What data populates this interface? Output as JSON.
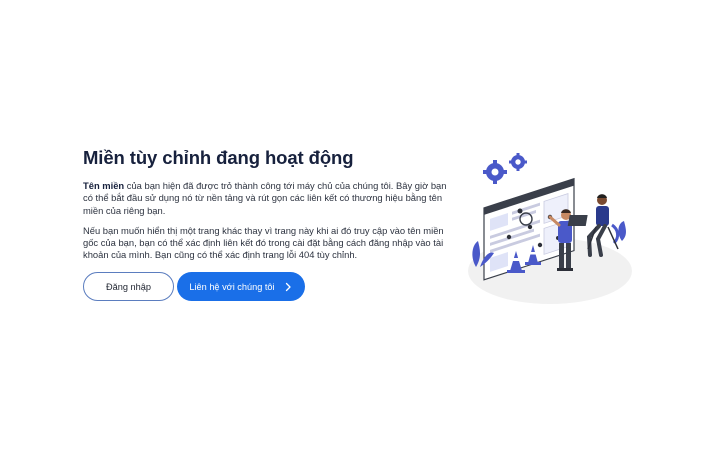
{
  "main": {
    "title": "Miền tùy chỉnh đang hoạt động",
    "p1_bold": "Tên miền",
    "p1_text": " của bạn hiện đã được trỏ thành công tới máy chủ của chúng tôi. Bây giờ bạn có thể bắt đầu sử dụng nó từ nền tảng và rút gọn các liên kết có thương hiệu bằng tên miền của riêng bạn.",
    "p2_text": "Nếu bạn muốn hiển thị một trang khác thay vì trang này khi ai đó truy cập vào tên miền gốc của bạn, bạn có thể xác định liên kết đó trong cài đặt bằng cách đăng nhập vào tài khoản của mình. Bạn cũng có thể xác định trang lỗi 404 tùy chỉnh."
  },
  "buttons": {
    "login_label": "Đăng nhập",
    "contact_label": "Liên hệ với chúng tôi"
  },
  "icons": {
    "contact_chevron": "chevron-right-icon",
    "illustration": "website-maintenance-illustration"
  },
  "colors": {
    "primary": "#1a6fe8",
    "title": "#17213d",
    "illustration_accent": "#4a59c9"
  }
}
